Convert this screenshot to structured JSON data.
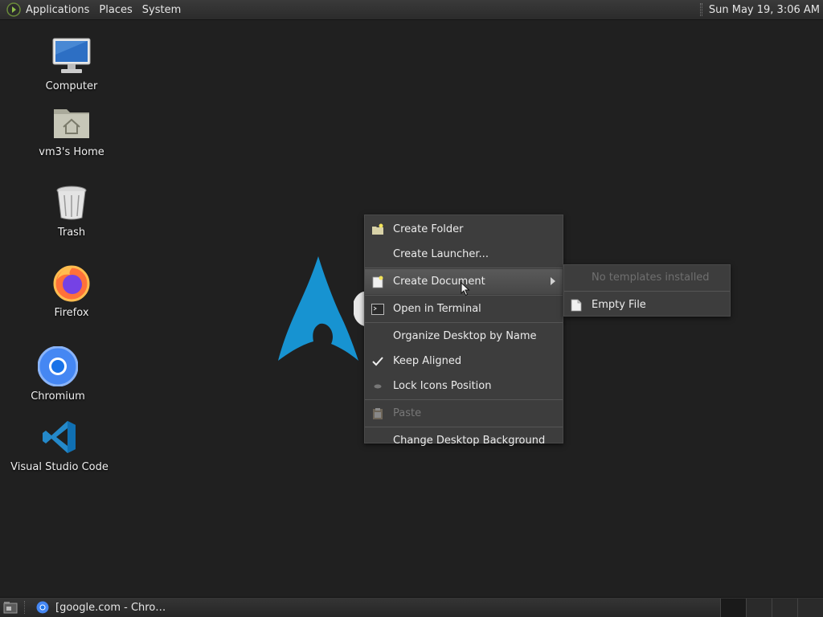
{
  "top_panel": {
    "menus": [
      "Applications",
      "Places",
      "System"
    ],
    "clock": "Sun May 19,  3:06 AM"
  },
  "desktop_icons": [
    {
      "label": "Computer",
      "icon": "computer-icon"
    },
    {
      "label": "vm3's Home",
      "icon": "home-folder-icon"
    },
    {
      "label": "Trash",
      "icon": "trash-icon"
    },
    {
      "label": "Firefox",
      "icon": "firefox-icon"
    },
    {
      "label": "Chromium",
      "icon": "chromium-icon"
    },
    {
      "label": "Visual Studio Code",
      "icon": "vscode-icon"
    }
  ],
  "context_menu": {
    "items": [
      {
        "label": "Create Folder",
        "icon": "new-folder-icon"
      },
      {
        "label": "Create Launcher...",
        "icon": ""
      },
      {
        "label": "Create Document",
        "icon": "new-document-icon",
        "submenu": true,
        "highlighted": true
      },
      {
        "label": "Open in Terminal",
        "icon": "terminal-icon"
      },
      {
        "label": "Organize Desktop by Name",
        "icon": ""
      },
      {
        "label": "Keep Aligned",
        "icon": "checkmark-icon",
        "checked": true
      },
      {
        "label": "Lock Icons Position",
        "icon": "lock-bullet-icon"
      },
      {
        "label": "Paste",
        "icon": "paste-icon",
        "disabled": true
      },
      {
        "label": "Change Desktop Background",
        "icon": ""
      }
    ]
  },
  "submenu": {
    "items": [
      {
        "label": "No templates installed",
        "disabled": true
      },
      {
        "label": "Empty File",
        "icon": "file-icon"
      }
    ]
  },
  "taskbar": {
    "tasks": [
      {
        "label": "[google.com - Chro…",
        "icon": "chromium-icon"
      }
    ],
    "workspace_count": 4,
    "active_workspace": 1
  },
  "colors": {
    "desktop_bg": "#202020",
    "menu_bg": "#3d3d3d",
    "arch_blue": "#1793d1"
  }
}
